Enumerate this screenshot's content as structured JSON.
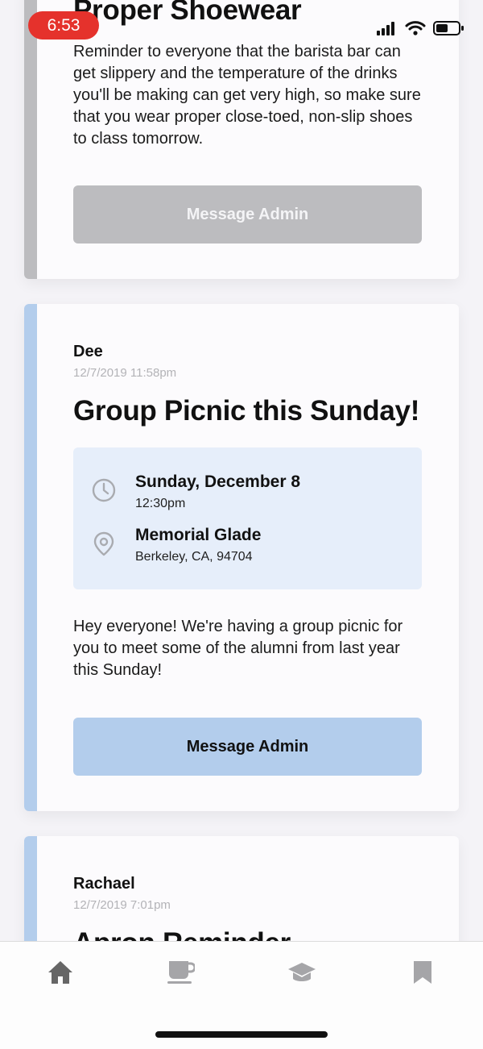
{
  "status_bar": {
    "time": "6:53"
  },
  "posts": [
    {
      "title": "Proper Shoewear",
      "body": "Reminder to everyone that the barista bar can get slippery and the temperature of the drinks you'll be making can get very high, so make sure that you wear proper close-toed, non-slip shoes to class tomorrow.",
      "button_label": "Message Admin",
      "accent": "#bcbcbf"
    },
    {
      "author": "Dee",
      "timestamp": "12/7/2019 11:58pm",
      "title": "Group Picnic this Sunday!",
      "event": {
        "date": "Sunday, December 8",
        "time": "12:30pm",
        "location_name": "Memorial Glade",
        "location_address": "Berkeley, CA, 94704"
      },
      "body": "Hey everyone! We're having a group picnic for you to meet some of the alumni from last year this Sunday!",
      "button_label": "Message Admin",
      "accent": "#b3cdec"
    },
    {
      "author": "Rachael",
      "timestamp": "12/7/2019 7:01pm",
      "title": "Apron Reminder",
      "accent": "#b3cdec"
    }
  ],
  "tabbar": {
    "items": [
      {
        "icon": "home-icon",
        "active": true
      },
      {
        "icon": "coffee-icon",
        "active": false
      },
      {
        "icon": "graduation-cap-icon",
        "active": false
      },
      {
        "icon": "bookmark-icon",
        "active": false
      }
    ]
  }
}
